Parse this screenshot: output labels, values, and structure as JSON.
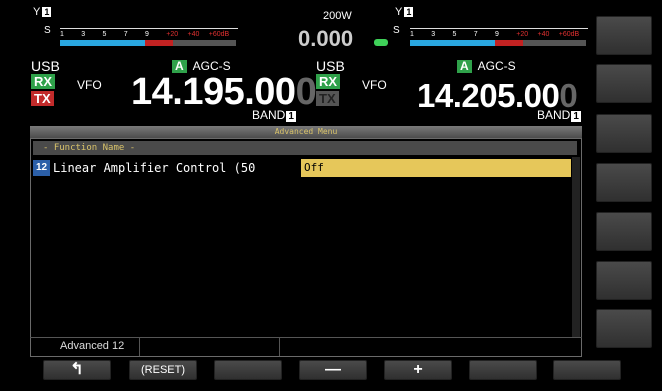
{
  "left_rx": {
    "antenna_num": "1",
    "smeter_label": "S",
    "smeter_ticks": [
      "1",
      "3",
      "5",
      "7",
      "9",
      "+20",
      "+40",
      "+60dB"
    ],
    "mode": "USB",
    "rx_badge": "RX",
    "tx_badge": "TX",
    "vfo": "VFO",
    "agc_a": "A",
    "agc": "AGC-S",
    "freq_main": "14.195.00",
    "freq_dim": "0",
    "band_label": "BAND",
    "band_num": "1"
  },
  "center": {
    "power": "200W",
    "offset": "0.000"
  },
  "right_rx": {
    "antenna_num": "1",
    "smeter_label": "S",
    "smeter_ticks": [
      "1",
      "3",
      "5",
      "7",
      "9",
      "+20",
      "+40",
      "+60dB"
    ],
    "mode": "USB",
    "rx_badge": "RX",
    "tx_badge": "TX",
    "vfo": "VFO",
    "agc_a": "A",
    "agc": "AGC-S",
    "freq_main": "14.205.00",
    "freq_dim": "0",
    "band_label": "BAND",
    "band_num": "1"
  },
  "menu": {
    "title": "Advanced Menu",
    "column_header": "- Function Name -",
    "rows": [
      {
        "index": "12",
        "name": "Linear Amplifier Control (50",
        "value": "Off"
      }
    ],
    "status": "Advanced 12"
  },
  "softkeys": [
    {
      "label": "↰",
      "icon": "return-arrow-icon"
    },
    {
      "label": "(RESET)"
    },
    {
      "label": ""
    },
    {
      "label": "—"
    },
    {
      "label": "+"
    },
    {
      "label": ""
    },
    {
      "label": ""
    }
  ],
  "colors": {
    "rx_green": "#2fa14a",
    "tx_red": "#c22b2b",
    "menu_highlight": "#e6c75a",
    "menu_gold_text": "#d9c36a",
    "meter_blue": "#2aa7e0"
  }
}
